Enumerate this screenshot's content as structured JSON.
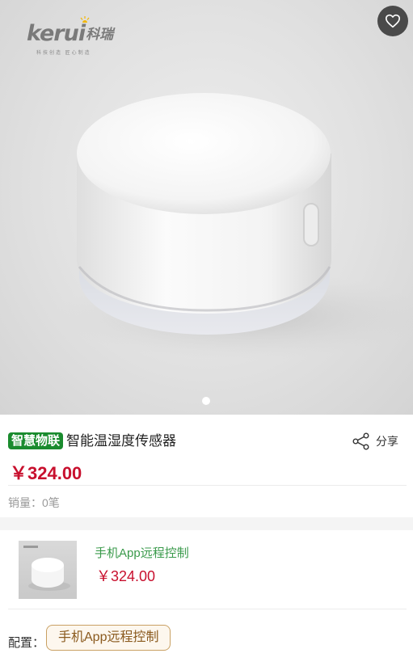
{
  "brand": {
    "logo_word": "kerui",
    "logo_cn": "科瑞",
    "tagline": "科技创造  匠心制造"
  },
  "icons": {
    "favorite": "heart-icon",
    "share": "share-icon"
  },
  "product": {
    "tag": "智慧物联",
    "title": "智能温湿度传感器",
    "share_label": "分享",
    "price": "￥324.00",
    "sales": "销量：0笔"
  },
  "sku": {
    "name": "手机App远程控制",
    "price": "￥324.00"
  },
  "config": {
    "label": "配置：",
    "selected": "手机App远程控制"
  },
  "colors": {
    "price": "#c8102e",
    "tag_bg": "#1a8b2e",
    "sku_name": "#3a9a4b",
    "chip_border": "#c9a063"
  }
}
